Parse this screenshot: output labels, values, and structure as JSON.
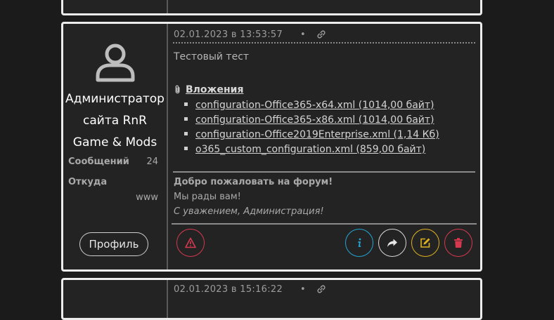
{
  "posts": {
    "main": {
      "author": {
        "name_lines": [
          "Администратор",
          "сайта RnR",
          "Game & Mods"
        ],
        "stats": [
          {
            "label": "Сообщений",
            "value": "24"
          },
          {
            "label": "Откуда",
            "value": "www"
          }
        ],
        "profile_button": "Профиль",
        "avatar_icon": "user-avatar-icon"
      },
      "datetime": "02.01.2023 в 13:53:57",
      "separator": "•",
      "permalink_icon": "link-icon",
      "message": "Тестовый тест",
      "attachments": {
        "title": "Вложения",
        "icon": "paperclip-icon",
        "files": [
          "configuration-Office365-x64.xml (1014,00 байт)",
          "configuration-Office365-x86.xml (1014,00 байт)",
          "configuration-Office2019Enterprise.xml (1,14 Кб)",
          "o365_custom_configuration.xml (859,00 байт)"
        ]
      },
      "signature": {
        "title": "Добро пожаловать на форум!",
        "line": "Мы рады вам!",
        "italic": "С уважением, Администрация!"
      },
      "actions": [
        {
          "name": "report",
          "icon": "warning-icon",
          "color": "#d6394f"
        },
        {
          "name": "info",
          "icon": "info-icon",
          "color": "#23a6d5"
        },
        {
          "name": "share",
          "icon": "share-arrow-icon",
          "color": "#d8d8d8"
        },
        {
          "name": "edit",
          "icon": "edit-icon",
          "color": "#e0b21e"
        },
        {
          "name": "delete",
          "icon": "trash-icon",
          "color": "#d6394f"
        }
      ]
    },
    "next": {
      "datetime": "02.01.2023 в 15:16:22",
      "separator": "•"
    }
  }
}
